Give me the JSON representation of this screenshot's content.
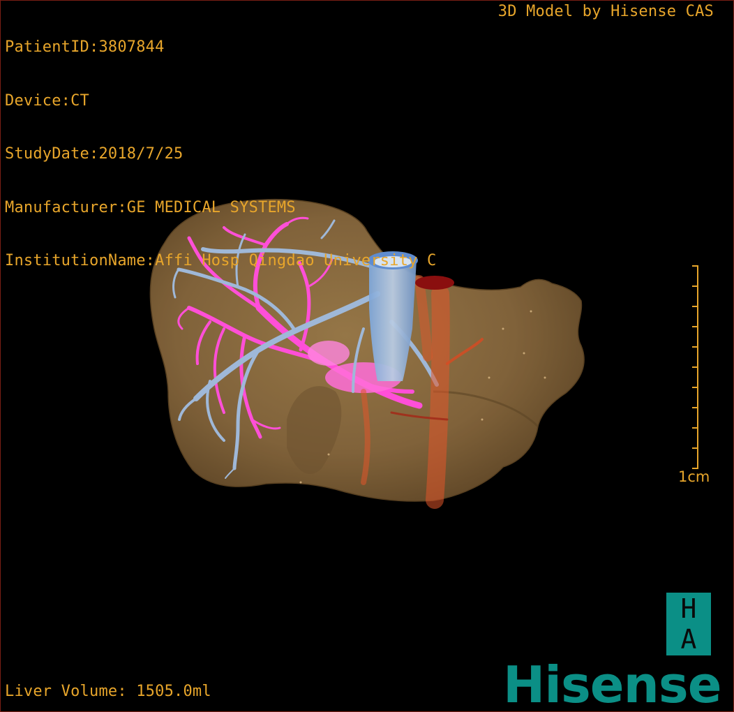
{
  "metadata": {
    "patient_id": "PatientID:3807844",
    "device": "Device:CT",
    "study_date": "StudyDate:2018/7/25",
    "manufacturer": "Manufacturer:GE MEDICAL SYSTEMS",
    "institution": "InstitutionName:Affi Hosp Qingdao University C"
  },
  "credit": "3D Model by Hisense CAS",
  "liver_volume": "Liver Volume: 1505.0ml",
  "scale": {
    "label": "1cm",
    "tick_count": 11
  },
  "logo": {
    "top_letter": "H",
    "bottom_letter": "A",
    "wordmark": "Hisense"
  },
  "colors": {
    "overlay_text": "#e8a62b",
    "liver": "#8a6a3e",
    "portal_vein": "#ff4fd8",
    "hepatic_vein": "#9fb8d8",
    "vena_cava": "#7ea6d8",
    "artery": "#e0562a",
    "brand": "#0b8f86"
  }
}
